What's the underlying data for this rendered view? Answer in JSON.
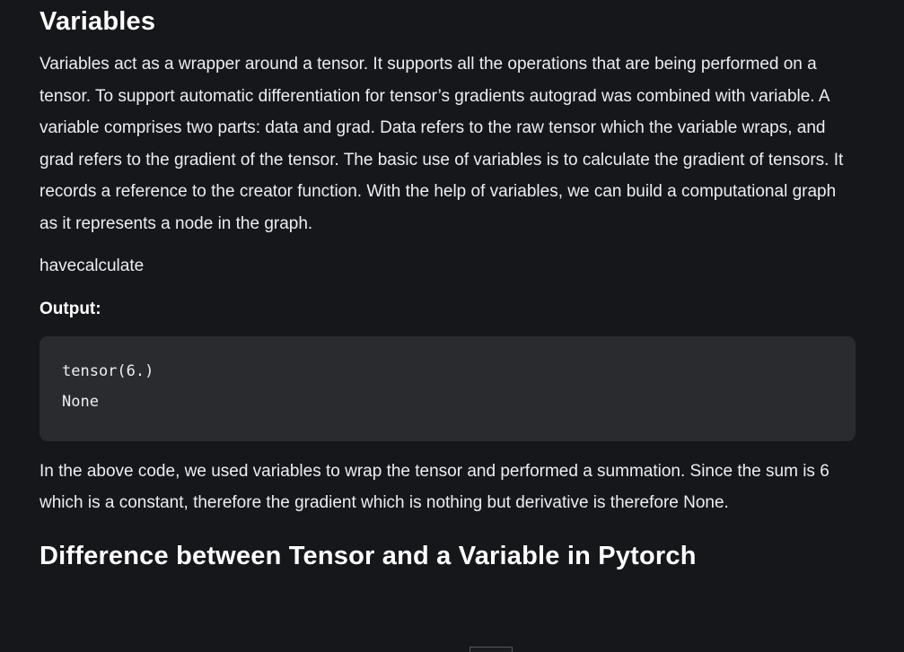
{
  "section": {
    "title": "Variables",
    "intro": "Variables act as a wrapper around a tensor. It supports all the operations that are being performed on a tensor. To support automatic differentiation for tensor’s gradients autograd was combined with variable. A variable comprises two parts: data and grad. Data refers to the raw tensor which the variable wraps, and grad refers to the gradient of the tensor. The basic use of variables is to calculate the gradient of tensors. It records a reference to the creator function. With the help of variables, we can build a computational graph as it represents a node in the graph.",
    "code_label": "havecalculate",
    "output_label": "Output:",
    "output_lines": [
      "tensor(6.)",
      "None"
    ],
    "explanation": "In the above code, we used variables to wrap the tensor and performed a summation. Since the sum is 6 which is a constant, therefore the gradient which is nothing but derivative is therefore None."
  },
  "next_section": {
    "title": "Difference between Tensor and a Variable in Pytorch"
  }
}
